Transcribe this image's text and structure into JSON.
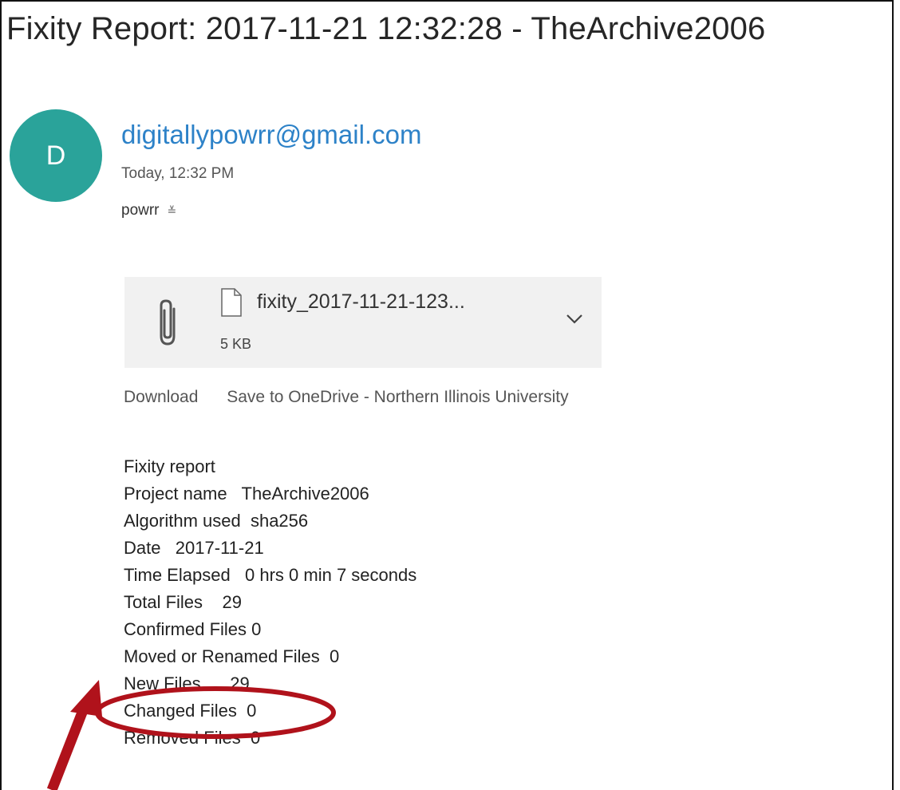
{
  "email": {
    "subject": "Fixity Report: 2017-11-21 12:32:28 - TheArchive2006",
    "avatar_initial": "D",
    "sender": "digitallypowrr@gmail.com",
    "timestamp": "Today, 12:32 PM",
    "recipient": "powrr",
    "expand_glyph": "≚"
  },
  "attachment": {
    "file_name": "fixity_2017-11-21-123...",
    "file_size": "5 KB"
  },
  "actions": {
    "download": "Download",
    "save": "Save to OneDrive - Northern Illinois University"
  },
  "report": {
    "lines": [
      "Fixity report",
      "Project name   TheArchive2006",
      "Algorithm used  sha256",
      "Date   2017-11-21",
      "Time Elapsed   0 hrs 0 min 7 seconds",
      "Total Files    29",
      "Confirmed Files 0",
      "Moved or Renamed Files  0",
      "New Files      29",
      "Changed Files  0",
      "Removed Files  0"
    ]
  },
  "colors": {
    "avatar": "#2aa39a",
    "sender_link": "#2d82c8",
    "annotation": "#b0121b"
  },
  "icons": [
    "paperclip-icon",
    "file-icon",
    "chevron-down-icon"
  ]
}
